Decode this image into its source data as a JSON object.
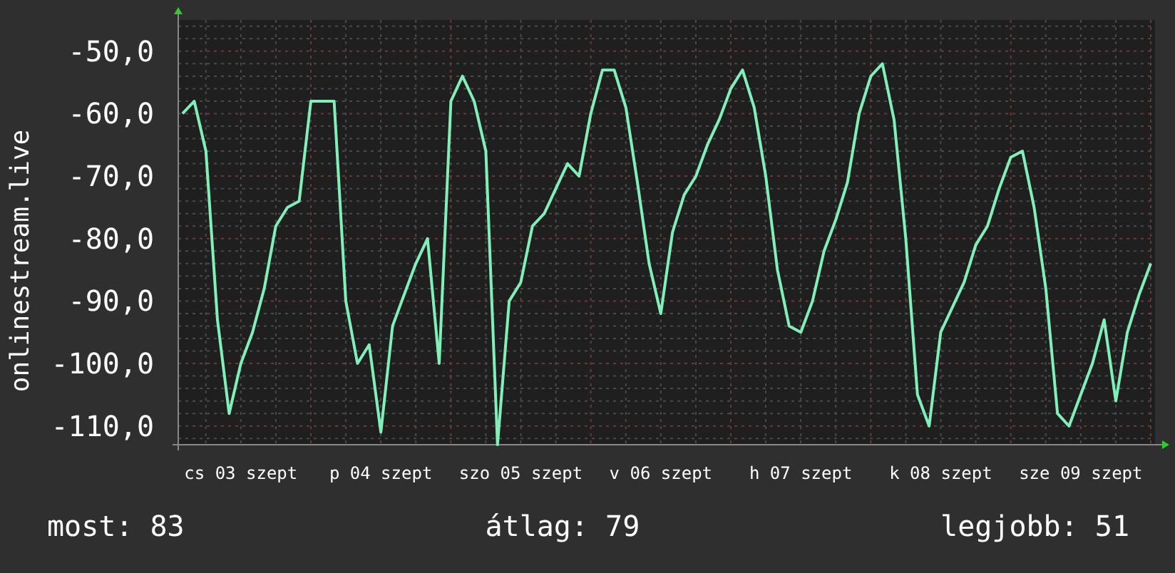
{
  "graph": {
    "chart_data": {
      "type": "line",
      "grid": true,
      "ylabel": "onlinestream.live",
      "ylim": [
        -113,
        -45
      ],
      "categories": [
        null,
        null,
        null,
        null,
        null,
        "cs 03 szept",
        null,
        null,
        null,
        null,
        null,
        null,
        null,
        null,
        null,
        null,
        null,
        "p 04 szept",
        null,
        null,
        null,
        null,
        null,
        null,
        null,
        null,
        null,
        null,
        null,
        "szo 05 szept",
        null,
        null,
        null,
        null,
        null,
        null,
        null,
        null,
        null,
        null,
        null,
        "v 06 szept",
        null,
        null,
        null,
        null,
        null,
        null,
        null,
        null,
        null,
        null,
        null,
        "h 07 szept",
        null,
        null,
        null,
        null,
        null,
        null,
        null,
        null,
        null,
        null,
        null,
        "k 08 szept",
        null,
        null,
        null,
        null,
        null,
        null,
        null,
        null,
        null,
        null,
        null,
        "sze 09 szept",
        null,
        null,
        null,
        null,
        null,
        null
      ],
      "yticks": [
        {
          "value": -50,
          "label": "-50,0"
        },
        {
          "value": -60,
          "label": "-60,0"
        },
        {
          "value": -70,
          "label": "-70,0"
        },
        {
          "value": -80,
          "label": "-80,0"
        },
        {
          "value": -90,
          "label": "-90,0"
        },
        {
          "value": -100,
          "label": "-100,0"
        },
        {
          "value": -110,
          "label": "-110,0"
        }
      ],
      "series": [
        {
          "color": "#80f0b8",
          "values": [
            -60,
            -58,
            -66,
            -93,
            -108,
            -100,
            -95,
            -88,
            -78,
            -75,
            -74,
            -58,
            -58,
            -58,
            -90,
            -100,
            -97,
            -111,
            -94,
            -89,
            -84,
            -80,
            -100,
            -58,
            -54,
            -58,
            -66,
            -113,
            -90,
            -87,
            -78,
            -76,
            -72,
            -68,
            -70,
            -60,
            -53,
            -53,
            -59,
            -71,
            -84,
            -92,
            -79,
            -73,
            -70,
            -65,
            -61,
            -56,
            -53,
            -59,
            -70,
            -85,
            -94,
            -95,
            -90,
            -82,
            -77,
            -71,
            -60,
            -54,
            -52,
            -61,
            -80,
            -105,
            -110,
            -95,
            -91,
            -87,
            -81,
            -78,
            -72,
            -67,
            -66,
            -75,
            -88,
            -108,
            -110,
            -105,
            -100,
            -93,
            -106,
            -95,
            -89,
            -84
          ]
        }
      ]
    }
  },
  "stats": [
    "most: 83",
    "átlag: 79",
    "legjobb: 51"
  ]
}
